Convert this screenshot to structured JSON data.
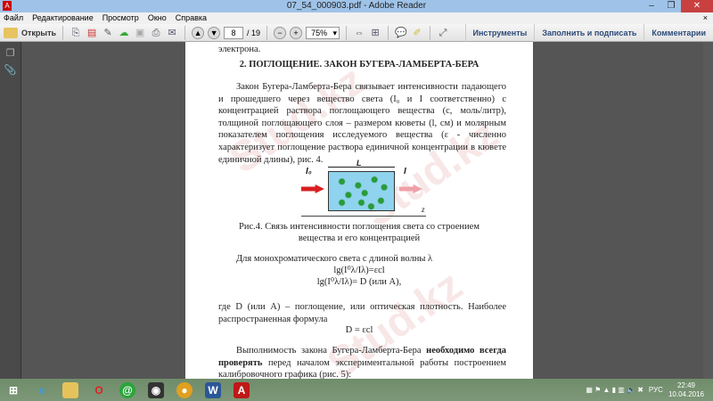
{
  "window": {
    "title": "07_54_000903.pdf - Adobe Reader",
    "minimize": "–",
    "restore": "❐",
    "close": "✕"
  },
  "menu": [
    "Файл",
    "Редактирование",
    "Просмотр",
    "Окно",
    "Справка"
  ],
  "menu_close": "×",
  "toolbar": {
    "open_label": "Открыть",
    "page_current": "8",
    "page_total": "/ 19",
    "zoom": "75%",
    "links": [
      "Инструменты",
      "Заполнить и подписать",
      "Комментарии"
    ]
  },
  "document": {
    "prev_tail": "электрона.",
    "heading": "2. ПОГЛОЩЕНИЕ. ЗАКОН БУГЕРА-ЛАМБЕРТА-БЕРА",
    "para1": "Закон Бугера-Ламберта-Бера связывает интенсивности падающего и прошедшего через вещество света (I₀ и I соответственно) с концентрацией раствора поглощающего вещества (c, моль/литр), толщиной поглощающего слоя – размером кюветы (l, см) и молярным показателем поглощения исследуемого вещества (ε - численно характеризует поглощение раствора единичной концентрации в кювете единичной длины), рис. 4.",
    "figure": {
      "L": "L",
      "I0": "I₀",
      "I": "I",
      "z": "z"
    },
    "caption": "Рис.4. Связь интенсивности поглощения света со строением вещества и его концентрацией",
    "para2": "Для монохроматического света с длиной волны λ",
    "formula1": "lg(I⁰λ/Iλ)=εcl",
    "formula2": "lg(I⁰λ/Iλ)= D (или A),",
    "para3": "где D (или A) – поглощение, или оптическая плотность. Наиболее распространенная формула",
    "formula3": "D = εcl",
    "para4_bold1": "Выполнимость закона Бугера-Ламберта-Бера",
    "para4_bold2": "необходимо всегда проверять",
    "para4_rest": "перед началом экспериментальной работы построением калибровочного графика (рис. 5):",
    "watermark": "Stud.kz"
  },
  "tray": {
    "lang": "РУС",
    "time": "22:49",
    "date": "10.04.2016"
  }
}
